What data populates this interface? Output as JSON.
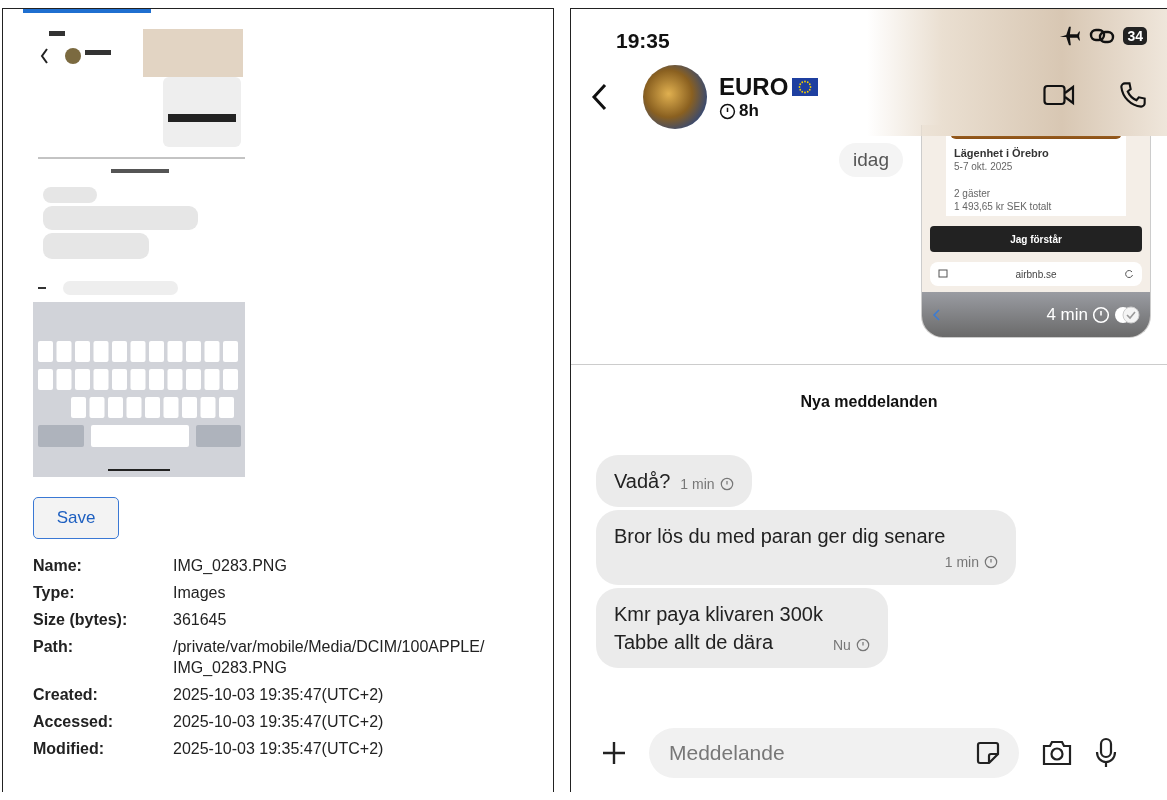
{
  "preview": {
    "save_button": "Save",
    "properties": [
      {
        "label": "Name:",
        "value": "IMG_0283.PNG"
      },
      {
        "label": "Type:",
        "value": "Images"
      },
      {
        "label": "Size (bytes):",
        "value": "361645"
      },
      {
        "label": "Path:",
        "value": "/private/var/mobile/Media/DCIM/100APPLE/IMG_0283.PNG",
        "kind": "path"
      },
      {
        "label": "Created:",
        "value": "2025-10-03 19:35:47(UTC+2)"
      },
      {
        "label": "Accessed:",
        "value": "2025-10-03 19:35:47(UTC+2)"
      },
      {
        "label": "Modified:",
        "value": "2025-10-03 19:35:47(UTC+2)"
      }
    ]
  },
  "phone": {
    "status_time": "19:35",
    "battery": "34",
    "contact": {
      "name": "EURO",
      "timer": "8h"
    },
    "date_pill": "idag",
    "shared_card": {
      "title": "Lägenhet i Örebro",
      "dates": "5-7 okt. 2025",
      "guests": "2 gäster",
      "price": "1 493,65 kr SEK totalt",
      "button": "Jag förstår",
      "url": "airbnb.se",
      "time": "4 min"
    },
    "divider_label": "Nya meddelanden",
    "messages": [
      {
        "text": "Vadå?",
        "time": "1 min"
      },
      {
        "text": "Bror lös du med paran ger dig senare",
        "time": "1 min"
      },
      {
        "text": "Kmr paya klivaren 300k\nTabbe allt de dära",
        "time": "Nu"
      }
    ],
    "composer": {
      "placeholder": "Meddelande"
    }
  }
}
